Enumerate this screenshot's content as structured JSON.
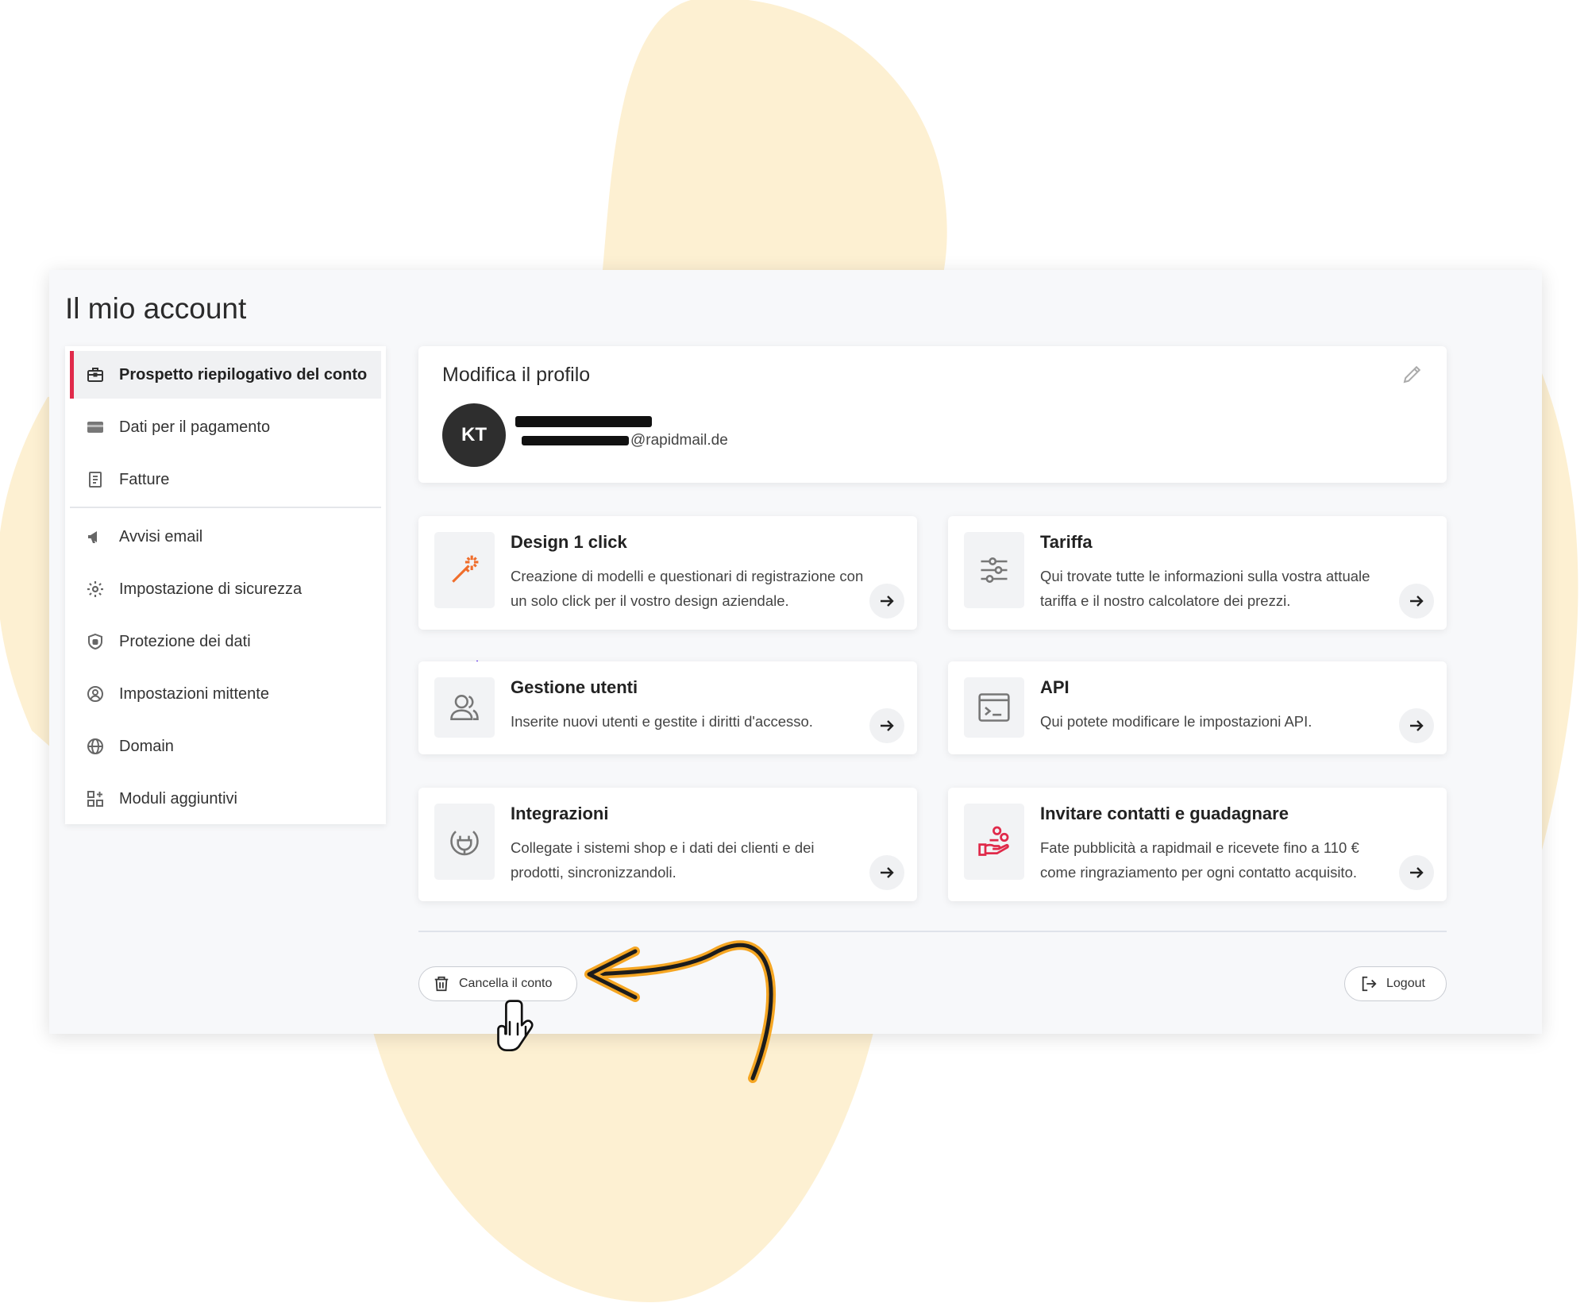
{
  "page": {
    "title": "Il mio account"
  },
  "sidebar": {
    "items": [
      {
        "label": "Prospetto riepilogativo del conto",
        "icon": "briefcase-icon",
        "active": true
      },
      {
        "label": "Dati per il pagamento",
        "icon": "credit-card-icon"
      },
      {
        "label": "Fatture",
        "icon": "invoice-icon"
      },
      {
        "label": "Avvisi email",
        "icon": "megaphone-icon"
      },
      {
        "label": "Impostazione di sicurezza",
        "icon": "gear-icon"
      },
      {
        "label": "Protezione dei dati",
        "icon": "shield-icon"
      },
      {
        "label": "Impostazioni mittente",
        "icon": "user-circle-icon"
      },
      {
        "label": "Domain",
        "icon": "globe-icon"
      },
      {
        "label": "Moduli aggiuntivi",
        "icon": "modules-icon"
      }
    ]
  },
  "profile": {
    "title": "Modifica il profilo",
    "initials": "KT",
    "email_domain": "@rapidmail.de"
  },
  "cards": [
    {
      "title": "Design 1 click",
      "description": "Creazione di modelli e questionari di registrazione con un solo click per il vostro design aziendale.",
      "icon": "magic-wand-icon"
    },
    {
      "title": "Tariffa",
      "description": "Qui trovate tutte le informazioni sulla vostra attuale tariffa e il nostro calcolatore dei prezzi.",
      "icon": "sliders-icon"
    },
    {
      "title": "Gestione utenti",
      "description": "Inserite nuovi utenti e gestite i diritti d'accesso.",
      "icon": "users-icon"
    },
    {
      "title": "API",
      "description": "Qui potete modificare le impostazioni API.",
      "icon": "terminal-icon"
    },
    {
      "title": "Integrazioni",
      "description": "Collegate i sistemi shop e i dati dei clienti e dei prodotti, sincronizzandoli.",
      "icon": "plug-icon"
    },
    {
      "title": "Invitare contatti e guadagnare",
      "description": "Fate pubblicità a rapidmail e ricevete fino a 110 € come ringraziamento per ogni contatto acquisito.",
      "icon": "referral-hand-icon"
    }
  ],
  "footer": {
    "delete_label": "Cancella il conto",
    "logout_label": "Logout"
  },
  "colors": {
    "accent": "#e02a4a",
    "blob": "#fdf0d2",
    "arrow": "#f5a623",
    "avatar": "#2e2e2e"
  }
}
